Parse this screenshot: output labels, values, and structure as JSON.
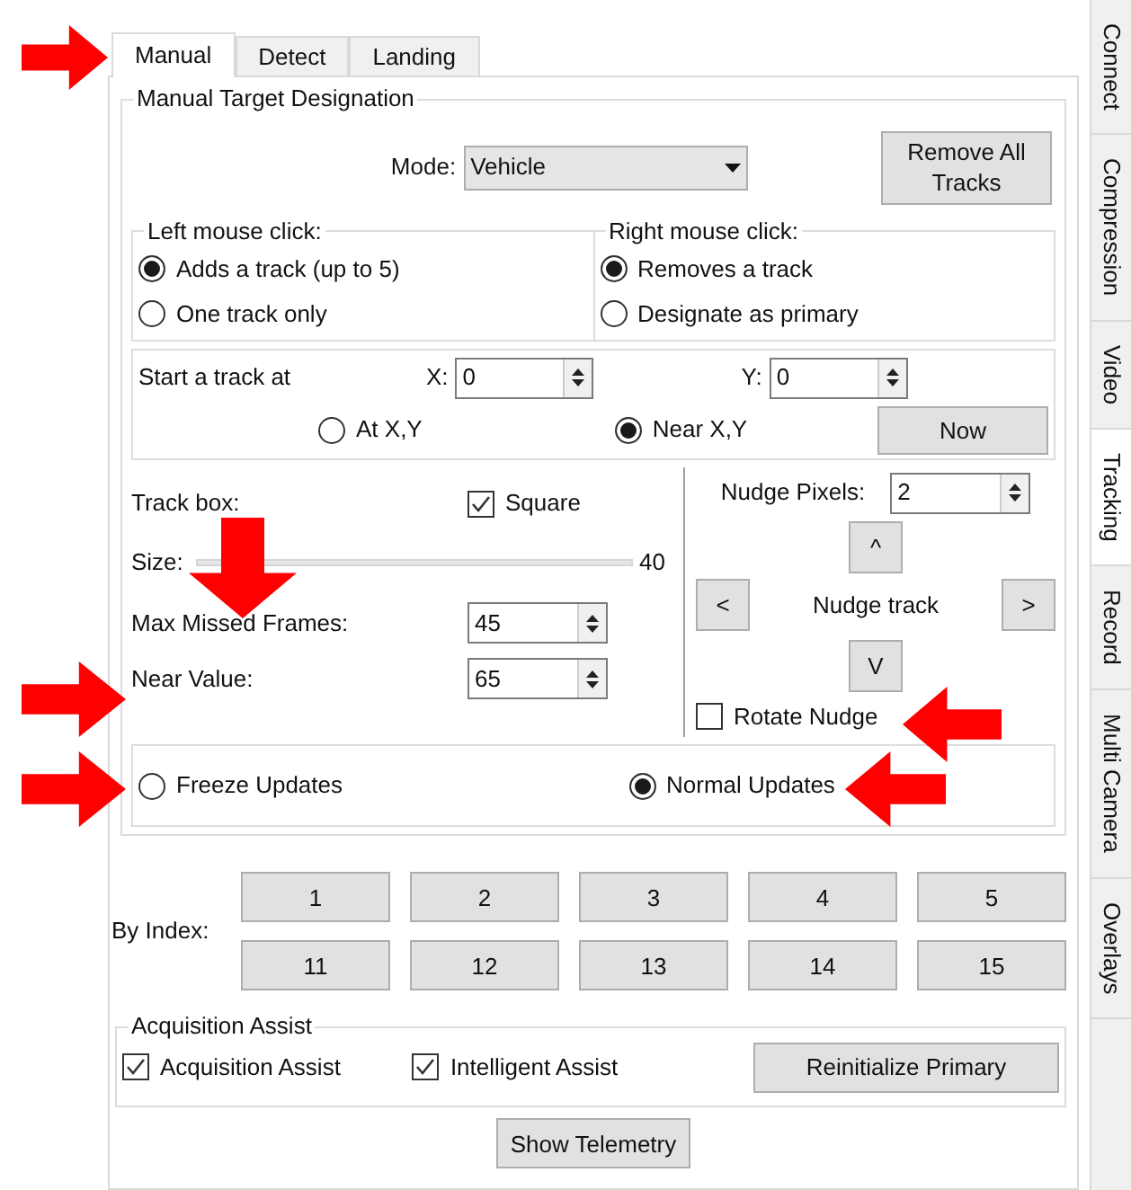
{
  "tabs": [
    {
      "label": "Manual",
      "selected": true
    },
    {
      "label": "Detect",
      "selected": false
    },
    {
      "label": "Landing",
      "selected": false
    }
  ],
  "side_tabs": [
    {
      "label": "Connect",
      "selected": false
    },
    {
      "label": "Compression",
      "selected": false
    },
    {
      "label": "Video",
      "selected": false
    },
    {
      "label": "Tracking",
      "selected": true
    },
    {
      "label": "Record",
      "selected": false
    },
    {
      "label": "Multi Camera",
      "selected": false
    },
    {
      "label": "Overlays",
      "selected": false
    }
  ],
  "manual_target": {
    "title": "Manual Target Designation",
    "mode": {
      "label": "Mode:",
      "value": "Vehicle"
    },
    "remove_button": "Remove All Tracks",
    "left_click": {
      "title": "Left mouse click:",
      "options": [
        {
          "label": "Adds a track (up to 5)",
          "selected": true
        },
        {
          "label": "One track only",
          "selected": false
        }
      ]
    },
    "right_click": {
      "title": "Right mouse click:",
      "options": [
        {
          "label": "Removes a track",
          "selected": true
        },
        {
          "label": "Designate as primary",
          "selected": false
        }
      ]
    },
    "start_track": {
      "label": "Start a track at",
      "x": {
        "label": "X:",
        "value": "0"
      },
      "y": {
        "label": "Y:",
        "value": "0"
      },
      "options": [
        {
          "label": "At X,Y",
          "selected": false
        },
        {
          "label": "Near X,Y",
          "selected": true
        }
      ],
      "now_button": "Now"
    },
    "track_box": {
      "label": "Track box:",
      "square": {
        "label": "Square",
        "checked": true
      },
      "size": {
        "label": "Size:",
        "reading": "40"
      },
      "max_missed": {
        "label": "Max Missed Frames:",
        "value": "45"
      },
      "near_value": {
        "label": "Near Value:",
        "value": "65"
      }
    },
    "nudge": {
      "pixels": {
        "label": "Nudge Pixels:",
        "value": "2"
      },
      "up": "^",
      "left": "<",
      "label": "Nudge track",
      "right": ">",
      "down": "V",
      "rotate": {
        "label": "Rotate Nudge",
        "checked": false
      }
    },
    "updates": [
      {
        "label": "Freeze Updates",
        "selected": false
      },
      {
        "label": "Normal Updates",
        "selected": true
      }
    ]
  },
  "by_index": {
    "label": "By Index:",
    "buttons": [
      "1",
      "2",
      "3",
      "4",
      "5",
      "11",
      "12",
      "13",
      "14",
      "15"
    ]
  },
  "acquisition": {
    "title": "Acquisition Assist",
    "checks": [
      {
        "label": "Acquisition Assist",
        "checked": true
      },
      {
        "label": "Intelligent Assist",
        "checked": true
      }
    ],
    "button": "Reinitialize Primary"
  },
  "telemetry_button": "Show Telemetry"
}
